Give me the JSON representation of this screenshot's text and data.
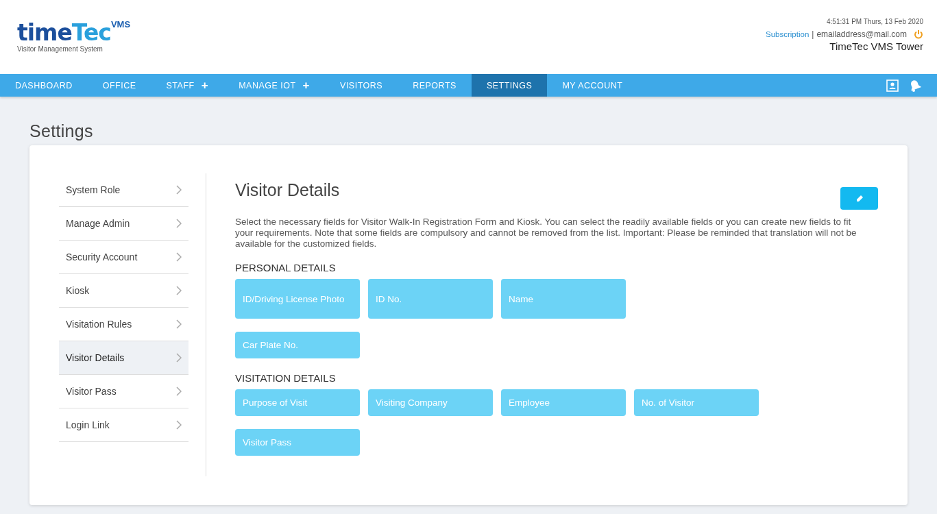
{
  "logo": {
    "word_dark": "time",
    "word_light": "Tec",
    "badge": "VMS",
    "tagline": "Visitor Management System"
  },
  "header": {
    "datetime": "4:51:31 PM  Thurs, 13 Feb 2020",
    "subscription_link": "Subscription",
    "separator": "|",
    "email": "emailaddress@mail.com",
    "company": "TimeTec VMS Tower"
  },
  "nav": [
    {
      "label": "DASHBOARD",
      "has_plus": false,
      "selected": false
    },
    {
      "label": "OFFICE",
      "has_plus": false,
      "selected": false
    },
    {
      "label": "STAFF",
      "has_plus": true,
      "selected": false
    },
    {
      "label": "MANAGE IOT",
      "has_plus": true,
      "selected": false
    },
    {
      "label": "VISITORS",
      "has_plus": false,
      "selected": false
    },
    {
      "label": "REPORTS",
      "has_plus": false,
      "selected": false
    },
    {
      "label": "SETTINGS",
      "has_plus": false,
      "selected": true
    },
    {
      "label": "MY ACCOUNT",
      "has_plus": false,
      "selected": false
    }
  ],
  "plus_glyph": "+",
  "page_title": "Settings",
  "sidebar": {
    "items": [
      {
        "label": "System Role",
        "selected": false
      },
      {
        "label": "Manage Admin",
        "selected": false
      },
      {
        "label": "Security Account",
        "selected": false
      },
      {
        "label": "Kiosk",
        "selected": false
      },
      {
        "label": "Visitation Rules",
        "selected": false
      },
      {
        "label": "Visitor Details",
        "selected": true
      },
      {
        "label": "Visitor Pass",
        "selected": false
      },
      {
        "label": "Login Link",
        "selected": false
      }
    ]
  },
  "content": {
    "title": "Visitor Details",
    "description": "Select the necessary fields for Visitor Walk-In Registration Form and Kiosk. You can select the readily available fields or you can create new fields to fit your requirements. Note that some fields are compulsory and cannot be removed from the list. Important: Please be reminded that translation will not be available for the customized fields.",
    "sections": [
      {
        "heading": "PERSONAL DETAILS",
        "rows": [
          [
            "ID/Driving License Photo",
            "ID No.",
            "Name"
          ],
          [
            "Car Plate No."
          ]
        ]
      },
      {
        "heading": "VISITATION DETAILS",
        "rows": [
          [
            "Purpose of Visit",
            "Visiting Company",
            "Employee",
            "No. of Visitor"
          ],
          [
            "Visitor Pass"
          ]
        ]
      }
    ]
  }
}
